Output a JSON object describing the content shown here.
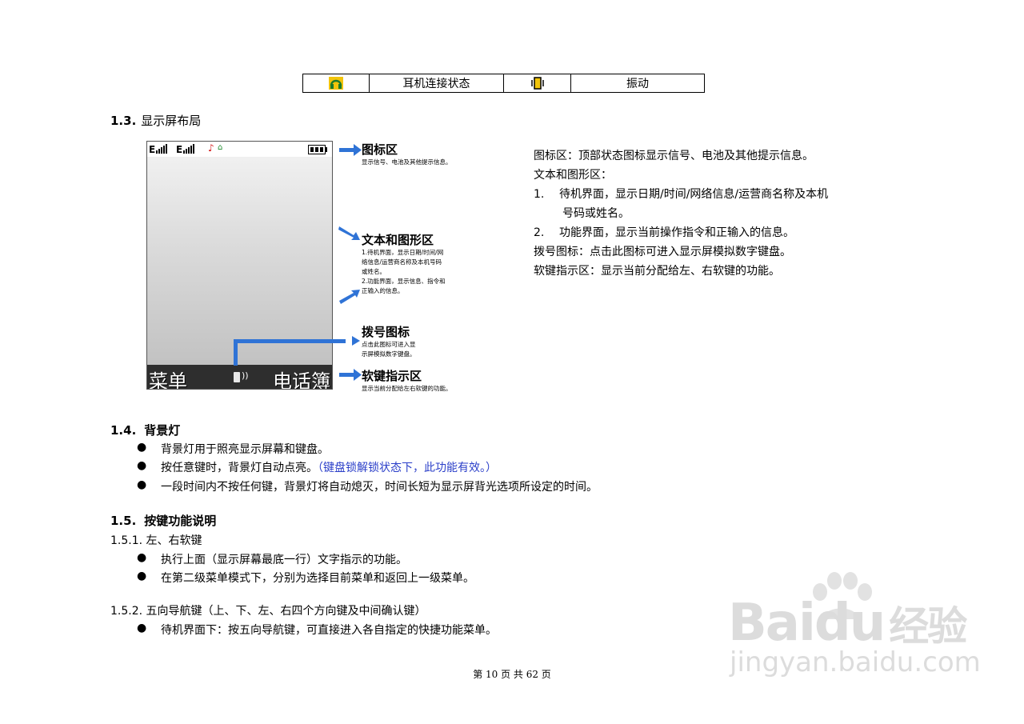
{
  "status_table": {
    "cell2": "耳机连接状态",
    "cell4": "振动",
    "headset_icon": "headset-icon",
    "vibrate_icon": "vibrate-icon"
  },
  "section_13": {
    "num": "1.3.",
    "title": "显示屏布局",
    "phone": {
      "left_softkey": "菜单",
      "right_softkey": "电话簿"
    },
    "callouts": [
      {
        "title": "图标区",
        "desc": "显示信号、电池及其他提示信息。"
      },
      {
        "title": "文本和图形区",
        "desc1": "1.待机界面，显示日期/时间/网",
        "desc2": "络信息/运营商名称及本机号码",
        "desc3": "或姓名。",
        "desc4": "2.功能界面，显示信息、指令和",
        "desc5": "正输入的信息。"
      },
      {
        "title": "拨号图标",
        "desc1": "点击此图标可进入显",
        "desc2": "示屏模拟数字键盘。"
      },
      {
        "title": "软键指示区",
        "desc": "显示当前分配给左右软键的功能。"
      }
    ],
    "description": {
      "line1": "图标区：顶部状态图标显示信号、电池及其他提示信息。",
      "line2": "文本和图形区：",
      "item1_num": "1.",
      "item1_a": "待机界面，显示日期/时间/网络信息/运营商名称及本机",
      "item1_b": "号码或姓名。",
      "item2_num": "2.",
      "item2": "功能界面，显示当前操作指令和正输入的信息。",
      "line5": "拨号图标：点击此图标可进入显示屏模拟数字键盘。",
      "line6": "软键指示区：显示当前分配给左、右软键的功能。"
    }
  },
  "section_14": {
    "num": "1.4.",
    "title": "背景灯",
    "bullets": [
      "背景灯用于照亮显示屏幕和键盘。",
      "按任意键时，背景灯自动点亮。",
      "一段时间内不按任何键，背景灯将自动熄灭，时间长短为显示屏背光选项所设定的时间。"
    ],
    "bullet2_note": "（键盘锁解锁状态下，此功能有效。）",
    "note_color": "#2b3fc9"
  },
  "section_15": {
    "num": "1.5.",
    "title": "按键功能说明",
    "sub1": "1.5.1. 左、右软键",
    "sub1_bullets": [
      "执行上面（显示屏幕最底一行）文字指示的功能。",
      "在第二级菜单模式下，分别为选择目前菜单和返回上一级菜单。"
    ],
    "sub2": "1.5.2. 五向导航键（上、下、左、右四个方向键及中间确认键）",
    "sub2_bullets": [
      "待机界面下：按五向导航键，可直接进入各自指定的快捷功能菜单。"
    ]
  },
  "footer": "第 10 页 共 62 页",
  "watermark": {
    "brand": "Baidu",
    "brand_suffix": "经验",
    "url": "jingyan.baidu.com"
  },
  "colors": {
    "arrow": "#2f73d6"
  }
}
